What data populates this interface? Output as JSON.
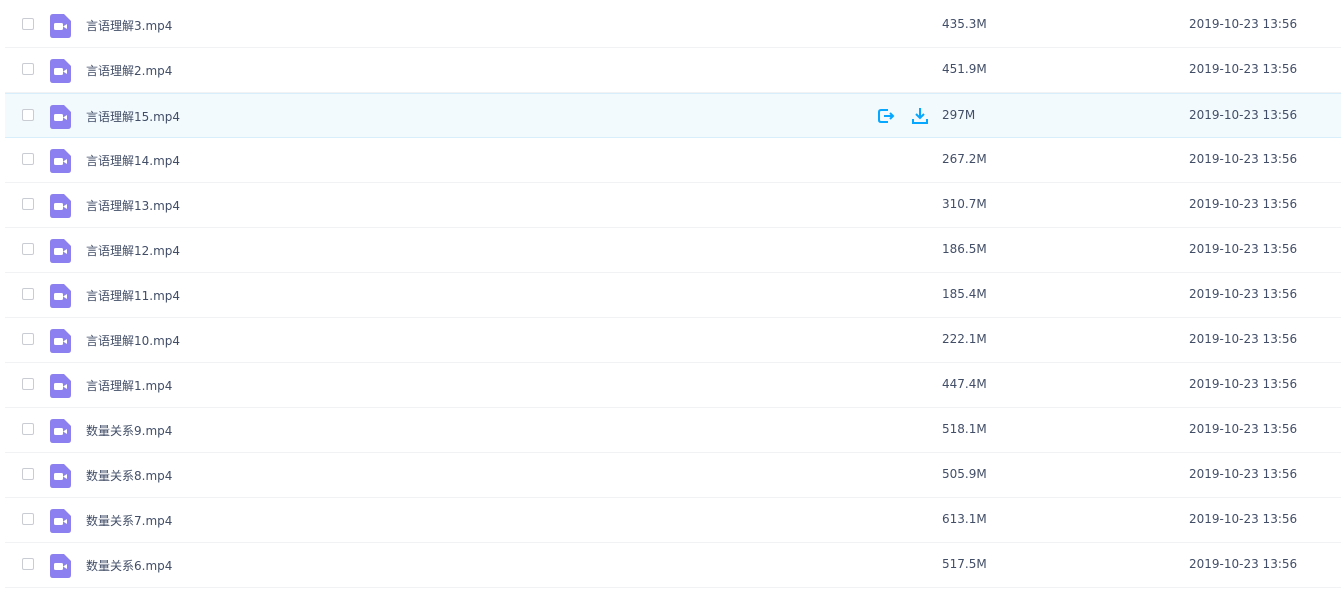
{
  "colors": {
    "accent": "#06a7ff",
    "file_icon": "#8c7ff0",
    "hover_row": "#f3fafe"
  },
  "icons": {
    "file": "video-file-icon",
    "share": "share-export-icon",
    "download": "download-icon"
  },
  "files": [
    {
      "name": "言语理解3.mp4",
      "size": "435.3M",
      "date": "2019-10-23 13:56"
    },
    {
      "name": "言语理解2.mp4",
      "size": "451.9M",
      "date": "2019-10-23 13:56"
    },
    {
      "name": "言语理解15.mp4",
      "size": "297M",
      "date": "2019-10-23 13:56",
      "hover": true
    },
    {
      "name": "言语理解14.mp4",
      "size": "267.2M",
      "date": "2019-10-23 13:56"
    },
    {
      "name": "言语理解13.mp4",
      "size": "310.7M",
      "date": "2019-10-23 13:56"
    },
    {
      "name": "言语理解12.mp4",
      "size": "186.5M",
      "date": "2019-10-23 13:56"
    },
    {
      "name": "言语理解11.mp4",
      "size": "185.4M",
      "date": "2019-10-23 13:56"
    },
    {
      "name": "言语理解10.mp4",
      "size": "222.1M",
      "date": "2019-10-23 13:56"
    },
    {
      "name": "言语理解1.mp4",
      "size": "447.4M",
      "date": "2019-10-23 13:56"
    },
    {
      "name": "数量关系9.mp4",
      "size": "518.1M",
      "date": "2019-10-23 13:56"
    },
    {
      "name": "数量关系8.mp4",
      "size": "505.9M",
      "date": "2019-10-23 13:56"
    },
    {
      "name": "数量关系7.mp4",
      "size": "613.1M",
      "date": "2019-10-23 13:56"
    },
    {
      "name": "数量关系6.mp4",
      "size": "517.5M",
      "date": "2019-10-23 13:56"
    }
  ]
}
